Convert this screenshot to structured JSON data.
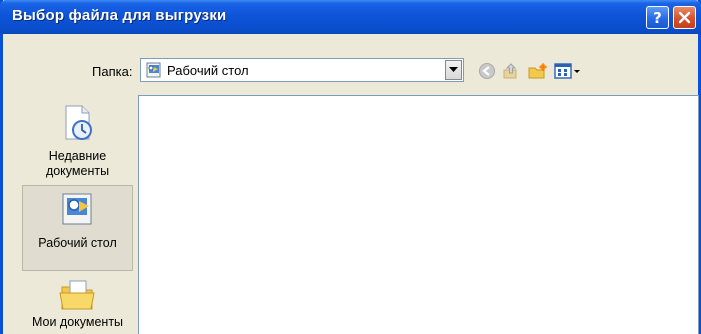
{
  "window": {
    "title": "Выбор файла для выгрузки"
  },
  "titlebar": {
    "help_glyph": "?",
    "help_icon": "help-icon",
    "close_icon": "close-icon"
  },
  "lookin": {
    "label": "Папка:",
    "value": "Рабочий стол",
    "icon": "desktop-icon",
    "dropdown_icon": "chevron-down-icon"
  },
  "toolbar": {
    "back_icon": "back-arrow-icon",
    "up_icon": "up-folder-icon",
    "new_folder_icon": "new-folder-icon",
    "views_icon": "views-menu-icon"
  },
  "places": [
    {
      "label_line1": "Недавние",
      "label_line2": "документы",
      "icon": "recent-documents-icon"
    },
    {
      "label_line1": "Рабочий стол",
      "label_line2": "",
      "icon": "desktop-icon"
    },
    {
      "label_line1": "Мои документы",
      "label_line2": "",
      "icon": "my-documents-icon"
    }
  ],
  "colors": {
    "titlebar": "#0a4fd8",
    "frame": "#ece9d8",
    "close": "#d4512b"
  }
}
